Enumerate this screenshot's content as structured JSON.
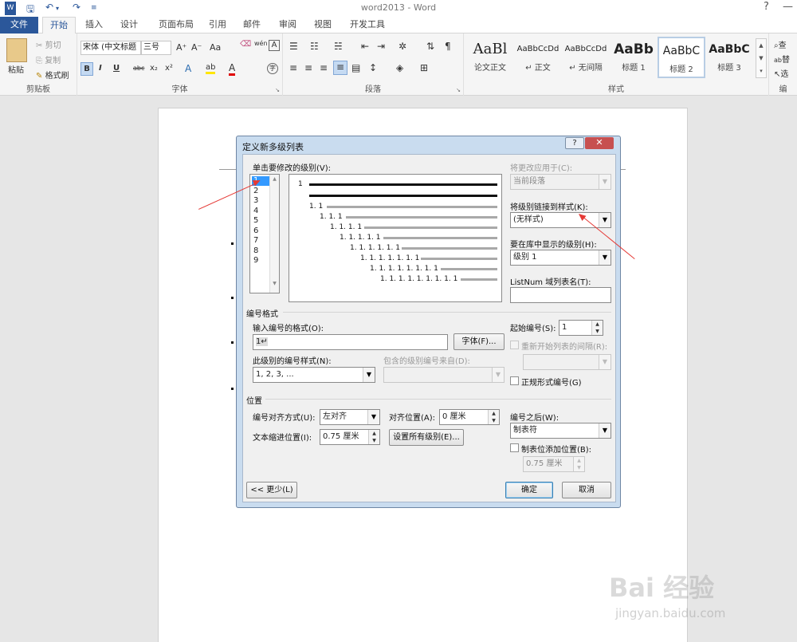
{
  "app": {
    "title": "word2013 - Word",
    "help_glyph": "?",
    "minimize_glyph": "—",
    "qa_icons": [
      "word-app-icon",
      "save-icon",
      "undo-icon",
      "redo-icon",
      "customize-icon"
    ]
  },
  "tabs": [
    {
      "label": "文件"
    },
    {
      "label": "开始"
    },
    {
      "label": "插入"
    },
    {
      "label": "设计"
    },
    {
      "label": "页面布局"
    },
    {
      "label": "引用"
    },
    {
      "label": "邮件"
    },
    {
      "label": "审阅"
    },
    {
      "label": "视图"
    },
    {
      "label": "开发工具"
    }
  ],
  "ribbon": {
    "clipboard": {
      "group": "剪贴板",
      "paste": "粘贴",
      "cut": "剪切",
      "copy": "复制",
      "format_painter": "格式刷"
    },
    "font": {
      "group": "字体",
      "font_name": "宋体 (中文标题",
      "font_size": "三号",
      "aa": "Aa",
      "bold": "B",
      "italic": "I",
      "underline": "U",
      "strike": "abc",
      "sub": "x₂",
      "sup": "x²",
      "wen": "wén",
      "a_box": "A",
      "grow": "A⁺",
      "shrink": "A⁻",
      "eff": "A",
      "hi": "ab",
      "fc": "A",
      "enc": "字"
    },
    "paragraph": {
      "group": "段落"
    },
    "styles": {
      "group": "样式",
      "items": [
        {
          "sample": "AaBl",
          "name": "论文正文"
        },
        {
          "sample": "AaBbCcDd",
          "name": "↵ 正文"
        },
        {
          "sample": "AaBbCcDd",
          "name": "↵ 无间隔"
        },
        {
          "sample": "AaBb",
          "name": "标题 1"
        },
        {
          "sample": "AaBbC",
          "name": "标题 2"
        },
        {
          "sample": "AaBbC",
          "name": "标题 3"
        }
      ]
    },
    "editing": {
      "group": "编",
      "find": "查",
      "replace": "替",
      "select": "选"
    }
  },
  "dialog": {
    "title": "定义新多级列表",
    "help": "?",
    "close": "✕",
    "level_label": "单击要修改的级别(V):",
    "levels": [
      "1",
      "2",
      "3",
      "4",
      "5",
      "6",
      "7",
      "8",
      "9"
    ],
    "apply_to_label": "将更改应用于(C):",
    "apply_to_value": "当前段落",
    "link_style_label": "将级别链接到样式(K):",
    "link_style_value": "(无样式)",
    "gallery_level_label": "要在库中显示的级别(H):",
    "gallery_level_value": "级别 1",
    "listnum_label": "ListNum 域列表名(T):",
    "listnum_value": "",
    "number_format_section": "编号格式",
    "enter_format_label": "输入编号的格式(O):",
    "enter_format_value": "1↵",
    "font_button": "字体(F)...",
    "start_at_label": "起始编号(S):",
    "start_at_value": "1",
    "restart_label": "重新开始列表的间隔(R):",
    "number_style_label": "此级别的编号样式(N):",
    "number_style_value": "1, 2, 3, ...",
    "include_from_label": "包含的级别编号来自(D):",
    "legal_label": "正规形式编号(G)",
    "position_section": "位置",
    "alignment_label": "编号对齐方式(U):",
    "alignment_value": "左对齐",
    "aligned_at_label": "对齐位置(A):",
    "aligned_at_value": "0 厘米",
    "follow_label": "编号之后(W):",
    "follow_value": "制表符",
    "indent_label": "文本缩进位置(I):",
    "indent_value": "0.75 厘米",
    "set_all_button": "设置所有级别(E)...",
    "tab_add_label": "制表位添加位置(B):",
    "tab_add_value": "0.75 厘米",
    "less_button": "<< 更少(L)",
    "ok_button": "确定",
    "cancel_button": "取消",
    "preview": [
      "1",
      "1. 1",
      "1. 1. 1",
      "1. 1. 1. 1",
      "1. 1. 1. 1. 1",
      "1. 1. 1. 1. 1. 1",
      "1. 1. 1. 1. 1. 1. 1",
      "1. 1. 1. 1. 1. 1. 1. 1",
      "1. 1. 1. 1. 1. 1. 1. 1. 1"
    ]
  },
  "watermark": {
    "brand": "Bai 经验",
    "url": "jingyan.baidu.com"
  }
}
